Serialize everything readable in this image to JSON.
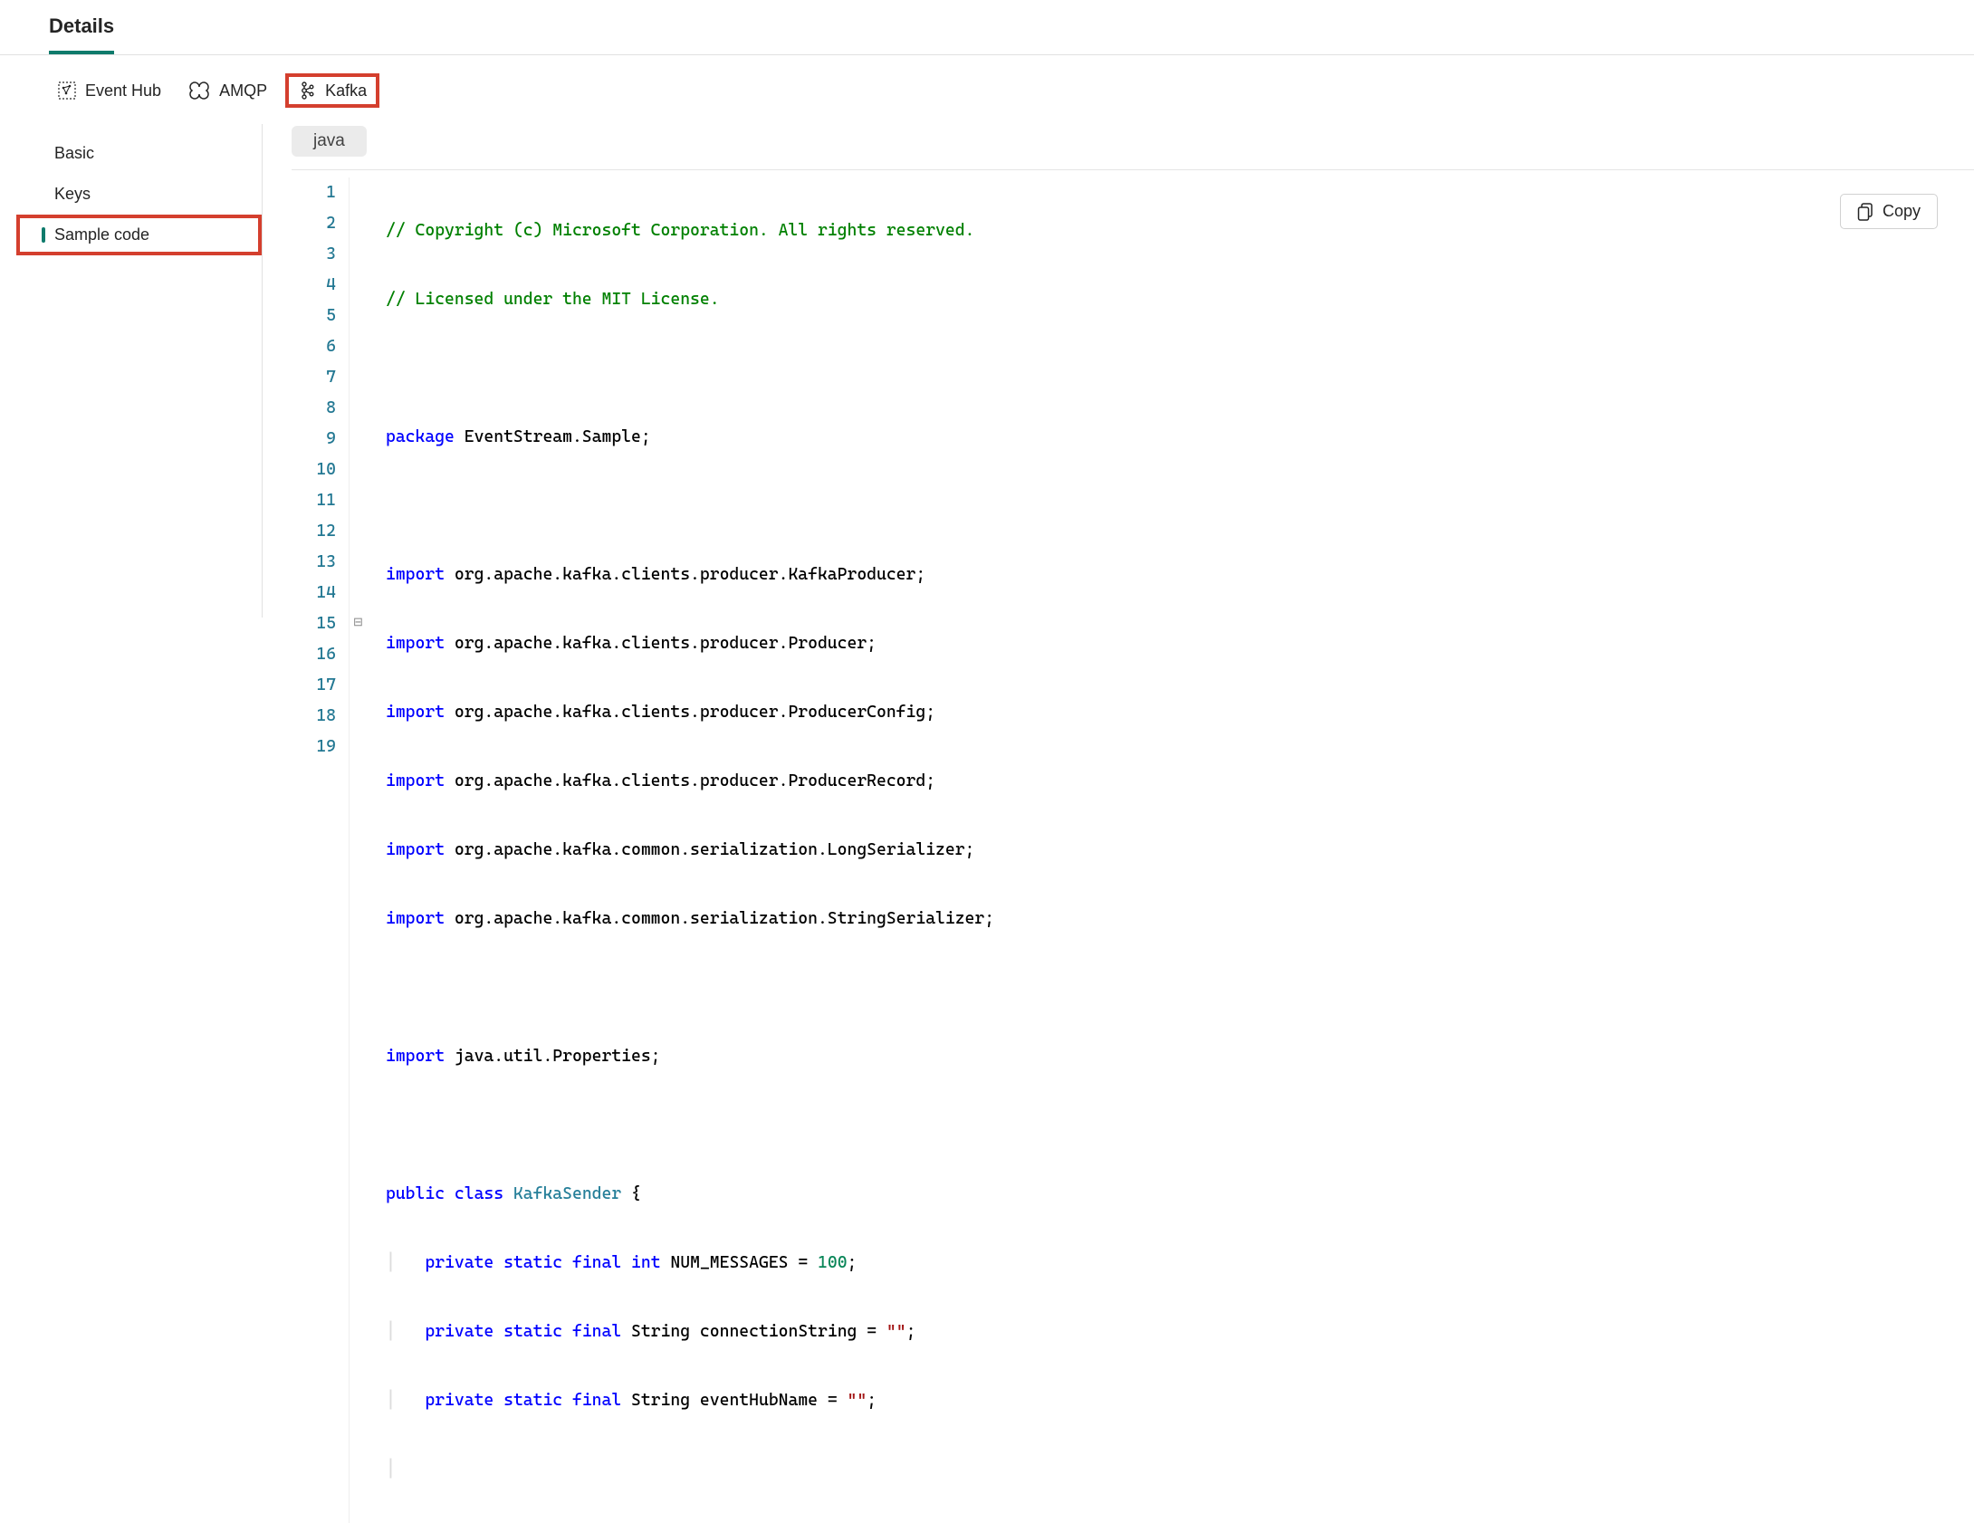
{
  "topTab": "Details",
  "protocolTabs": {
    "eventHub": "Event Hub",
    "amqp": "AMQP",
    "kafka": "Kafka"
  },
  "sidebar": {
    "basic": "Basic",
    "keys": "Keys",
    "sampleCode": "Sample code"
  },
  "language": "java",
  "copyLabel": "Copy",
  "code": {
    "line1": "// Copyright (c) Microsoft Corporation. All rights reserved.",
    "line2": "// Licensed under the MIT License.",
    "pkgKw": "package",
    "pkgName": " EventStream.Sample;",
    "impKw": "import",
    "imp1": " org.apache.kafka.clients.producer.KafkaProducer;",
    "imp2": " org.apache.kafka.clients.producer.Producer;",
    "imp3": " org.apache.kafka.clients.producer.ProducerConfig;",
    "imp4": " org.apache.kafka.clients.producer.ProducerRecord;",
    "imp5": " org.apache.kafka.common.serialization.LongSerializer;",
    "imp6": " org.apache.kafka.common.serialization.StringSerializer;",
    "imp7": " java.util.Properties;",
    "publicKw": "public",
    "classKw": "class",
    "className": " KafkaSender ",
    "braceOpen": "{",
    "privateKw": "private",
    "staticKw": "static",
    "finalKw": "final",
    "intKw": "int",
    "numMsgName": " NUM_MESSAGES = ",
    "numMsgVal": "100",
    "semi": ";",
    "stringType": " String",
    "connName": " connectionString = ",
    "emptyStr": "\"\"",
    "hubName": " eventHubName = "
  },
  "lineNumbers": [
    "1",
    "2",
    "3",
    "4",
    "5",
    "6",
    "7",
    "8",
    "9",
    "10",
    "11",
    "12",
    "13",
    "14",
    "15",
    "16",
    "17",
    "18",
    "19"
  ]
}
